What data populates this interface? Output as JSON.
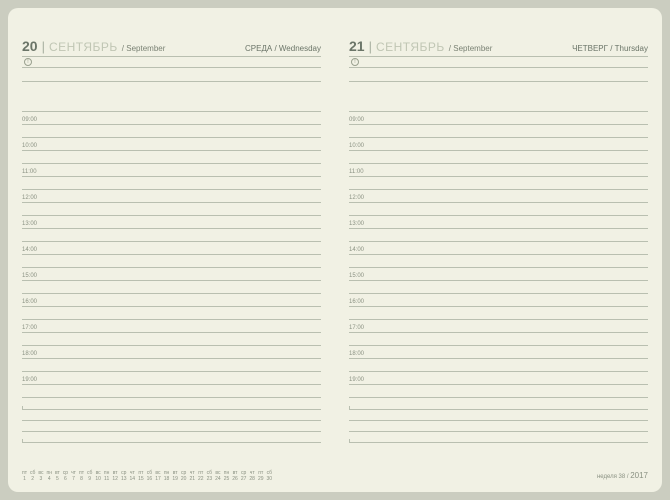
{
  "left": {
    "dayNum": "20",
    "monthRu": "СЕНТЯБРЬ",
    "monthEn": "/ September",
    "weekday": "СРЕДА / Wednesday"
  },
  "right": {
    "dayNum": "21",
    "monthRu": "СЕНТЯБРЬ",
    "monthEn": "/ September",
    "weekday": "ЧЕТВЕРГ / Thursday"
  },
  "hours": [
    "09:00",
    "10:00",
    "11:00",
    "12:00",
    "13:00",
    "14:00",
    "15:00",
    "16:00",
    "17:00",
    "18:00",
    "19:00"
  ],
  "calendar": {
    "dow": [
      "пт",
      "сб",
      "вс",
      "пн",
      "вт",
      "ср",
      "чт",
      "пт",
      "сб",
      "вс",
      "пн",
      "вт",
      "ср",
      "чт",
      "пт",
      "сб",
      "вс",
      "пн",
      "вт",
      "ср",
      "чт",
      "пт",
      "сб",
      "вс",
      "пн",
      "вт",
      "ср",
      "чт",
      "пт",
      "сб"
    ],
    "num": [
      "1",
      "2",
      "3",
      "4",
      "5",
      "6",
      "7",
      "8",
      "9",
      "10",
      "11",
      "12",
      "13",
      "14",
      "15",
      "16",
      "17",
      "18",
      "19",
      "20",
      "21",
      "22",
      "23",
      "24",
      "25",
      "26",
      "27",
      "28",
      "29",
      "30"
    ]
  },
  "footer": {
    "weekLabel": "неделя 38 /",
    "year": "2017"
  }
}
